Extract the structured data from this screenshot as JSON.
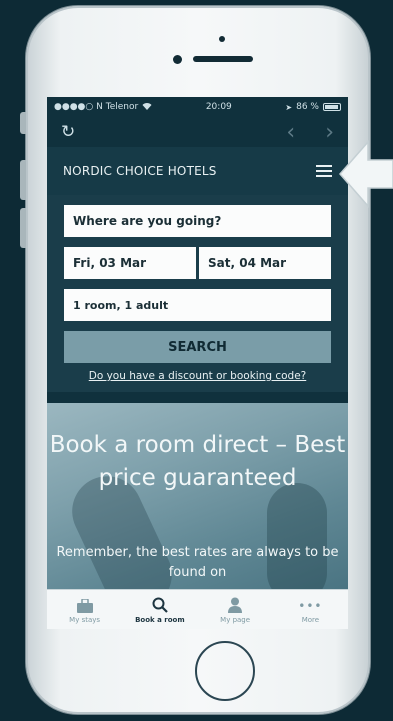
{
  "status": {
    "carrier": "●●●●○ N Telenor",
    "time": "20:09",
    "battery": "86 %"
  },
  "browser": {
    "reload_icon": "reload-icon",
    "back_icon": "chevron-left-icon",
    "forward_icon": "chevron-right-icon"
  },
  "header": {
    "brand": "NORDIC CHOICE HOTELS",
    "menu_icon": "hamburger-menu-icon"
  },
  "search": {
    "destination": "Where are you going?",
    "checkin": "Fri, 03 Mar",
    "checkout": "Sat, 04 Mar",
    "rooms": "1 room, 1 adult",
    "button": "SEARCH",
    "discount_link": "Do you have a discount or booking code?"
  },
  "hero": {
    "title": "Book a room direct – Best price guaranteed",
    "subtitle": "Remember, the best rates are always to be found on"
  },
  "tabs": [
    {
      "label": "My stays",
      "icon": "suitcase-icon",
      "active": false
    },
    {
      "label": "Book a room",
      "icon": "search-icon",
      "active": true
    },
    {
      "label": "My page",
      "icon": "person-icon",
      "active": false
    },
    {
      "label": "More",
      "icon": "more-dots-icon",
      "active": false
    }
  ],
  "colors": {
    "background": "#0d2a35",
    "brand_bar": "#163a47",
    "search_button": "#7a9da8"
  }
}
